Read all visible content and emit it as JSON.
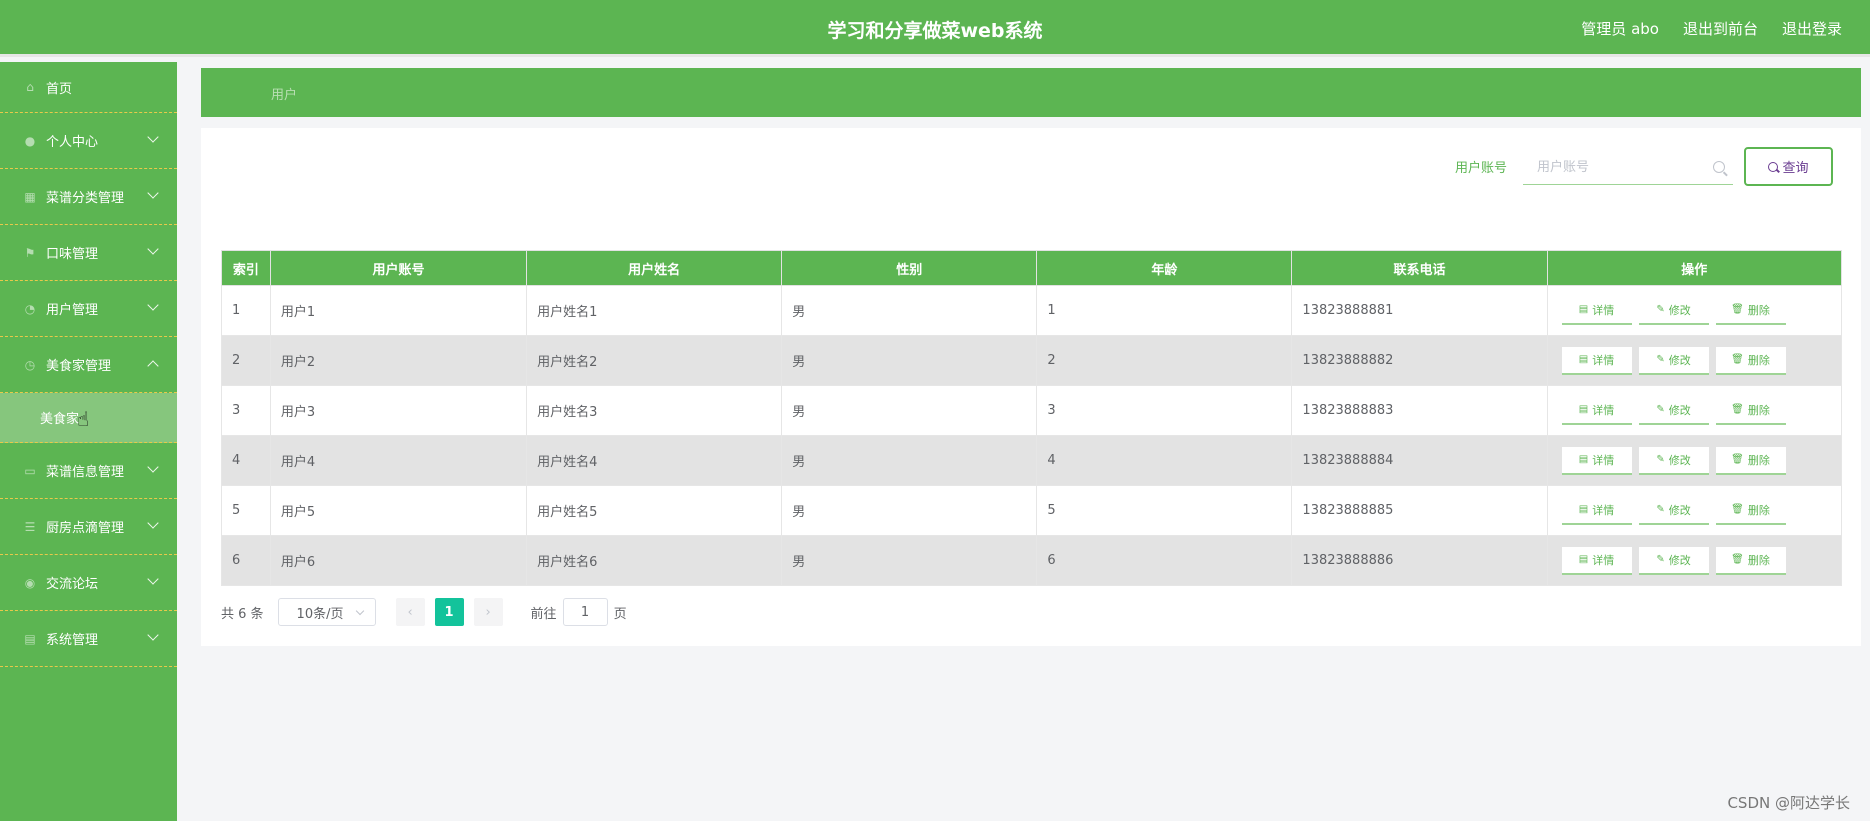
{
  "header": {
    "title": "学习和分享做菜web系统",
    "admin": "管理员 abo",
    "to_front": "退出到前台",
    "logout": "退出登录"
  },
  "sidebar": {
    "items": [
      {
        "label": "首页",
        "icon": "home-icon",
        "chevron": "none"
      },
      {
        "label": "个人中心",
        "icon": "user-icon",
        "chevron": "down"
      },
      {
        "label": "菜谱分类管理",
        "icon": "grid-icon",
        "chevron": "down"
      },
      {
        "label": "口味管理",
        "icon": "flag-icon",
        "chevron": "down"
      },
      {
        "label": "用户管理",
        "icon": "team-icon",
        "chevron": "down"
      },
      {
        "label": "美食家管理",
        "icon": "clock-icon",
        "chevron": "up"
      },
      {
        "label": "菜谱信息管理",
        "icon": "doc-icon",
        "chevron": "down"
      },
      {
        "label": "厨房点滴管理",
        "icon": "list-icon",
        "chevron": "down"
      },
      {
        "label": "交流论坛",
        "icon": "chat-icon",
        "chevron": "down"
      },
      {
        "label": "系统管理",
        "icon": "setting-icon",
        "chevron": "down"
      }
    ],
    "sub_item": "美食家"
  },
  "breadcrumb": "用户",
  "search": {
    "label": "用户账号",
    "placeholder": "用户账号",
    "button": "查询"
  },
  "table": {
    "headers": [
      "索引",
      "用户账号",
      "用户姓名",
      "性别",
      "年龄",
      "联系电话",
      "操作"
    ],
    "rows": [
      [
        "1",
        "用户1",
        "用户姓名1",
        "男",
        "1",
        "13823888881"
      ],
      [
        "2",
        "用户2",
        "用户姓名2",
        "男",
        "2",
        "13823888882"
      ],
      [
        "3",
        "用户3",
        "用户姓名3",
        "男",
        "3",
        "13823888883"
      ],
      [
        "4",
        "用户4",
        "用户姓名4",
        "男",
        "4",
        "13823888884"
      ],
      [
        "5",
        "用户5",
        "用户姓名5",
        "男",
        "5",
        "13823888885"
      ],
      [
        "6",
        "用户6",
        "用户姓名6",
        "男",
        "6",
        "13823888886"
      ]
    ],
    "actions": {
      "detail": "详情",
      "edit": "修改",
      "delete": "删除"
    }
  },
  "pagination": {
    "total": "共 6 条",
    "page_size": "10条/页",
    "current_page": "1",
    "goto_prefix": "前往",
    "goto_value": "1",
    "goto_suffix": "页",
    "prev": "‹",
    "next": "›"
  },
  "watermark": "CSDN @阿达学长"
}
